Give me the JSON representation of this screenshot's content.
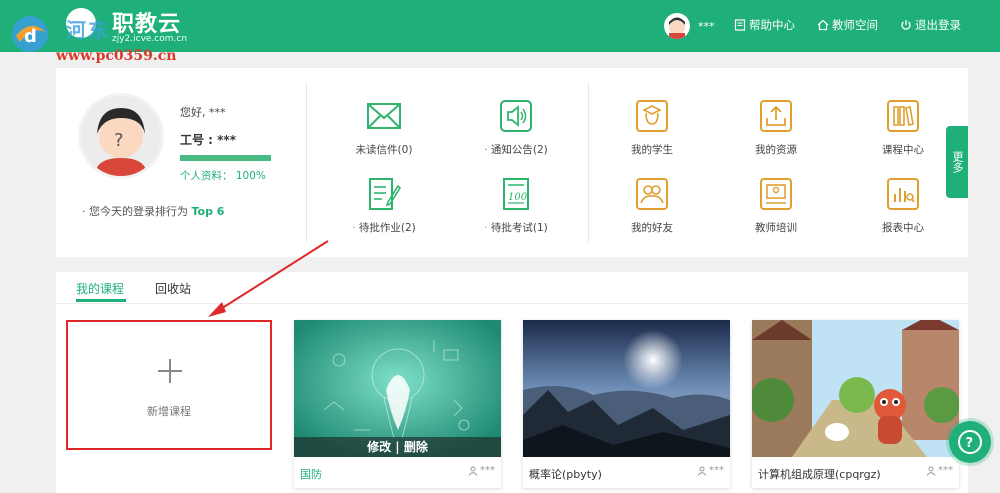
{
  "watermark": {
    "text": "河东",
    "url": "www.pc0359.cn"
  },
  "header": {
    "brand": "职教云",
    "brand_sub": "zjy2.icve.com.cn",
    "user_name": "***",
    "help_label": "帮助中心",
    "teacher_space_label": "教师空间",
    "logout_label": "退出登录",
    "accent": "#1fb07a"
  },
  "profile": {
    "greeting": "您好, ***",
    "id_line": "工号 : ***",
    "profile_label": "个人资料：",
    "profile_percent": "100%",
    "profile_progress": 1.0,
    "rank_prefix": "您今天的登录排行为",
    "rank_value": "Top 6"
  },
  "tiles": {
    "unread_mail": "未读信件(0)",
    "notice": "通知公告(2)",
    "my_students": "我的学生",
    "my_resources": "我的资源",
    "course_center": "课程中心",
    "pending_homework": "待批作业(2)",
    "pending_exams": "待批考试(1)",
    "my_friends": "我的好友",
    "teacher_training": "教师培训",
    "report_center": "报表中心",
    "more_label": "更多"
  },
  "courses": {
    "tab_my": "我的课程",
    "tab_recycle": "回收站",
    "add_label": "新增课程",
    "edit_delete": "修改 | 删除",
    "items": [
      {
        "title": "国防",
        "owner": "***"
      },
      {
        "title": "概率论(pbyty)",
        "owner": "***"
      },
      {
        "title": "计算机组成原理(cpqrgz)",
        "owner": "***"
      }
    ]
  }
}
